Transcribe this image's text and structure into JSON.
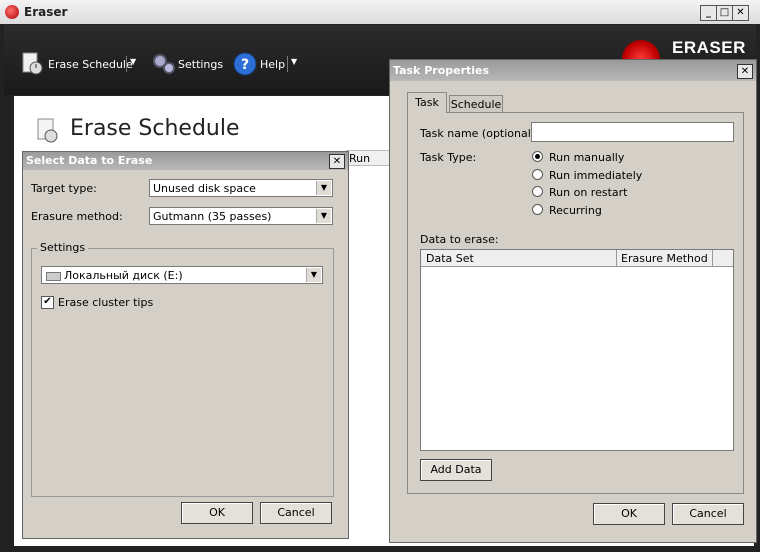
{
  "window": {
    "title": "Eraser"
  },
  "toolbar": {
    "erase_schedule": "Erase Schedule",
    "settings": "Settings",
    "help": "Help"
  },
  "logo": {
    "text": "ERASER"
  },
  "page": {
    "title": "Erase Schedule",
    "column_run": "Run"
  },
  "select_dialog": {
    "title": "Select Data to Erase",
    "target_type_label": "Target type:",
    "target_type_value": "Unused disk space",
    "erasure_method_label": "Erasure method:",
    "erasure_method_value": "Gutmann (35 passes)",
    "settings_group": "Settings",
    "drive_value": "Локальный диск (E:)",
    "erase_cluster_tips": "Erase cluster tips",
    "erase_cluster_tips_checked": true,
    "ok": "OK",
    "cancel": "Cancel"
  },
  "task_dialog": {
    "title": "Task Properties",
    "tabs": [
      "Task",
      "Schedule"
    ],
    "task_name_label": "Task name (optional):",
    "task_name_value": "",
    "task_type_label": "Task Type:",
    "task_types": [
      "Run manually",
      "Run immediately",
      "Run on restart",
      "Recurring"
    ],
    "selected_task_type": "Run manually",
    "data_to_erase_label": "Data to erase:",
    "columns": [
      "Data Set",
      "Erasure Method"
    ],
    "add_data": "Add Data",
    "ok": "OK",
    "cancel": "Cancel"
  },
  "colors": {
    "titlebar_dark": "#1a1a1a",
    "logo_red": "#c00000",
    "dialog_bg": "#d4d0c8"
  }
}
